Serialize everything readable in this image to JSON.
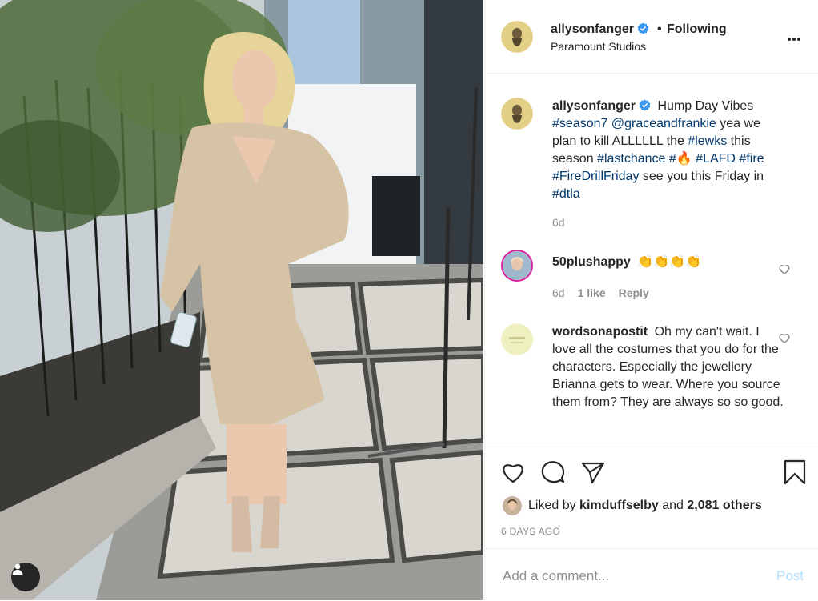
{
  "header": {
    "username": "allysonfanger",
    "separator": "•",
    "follow_status": "Following",
    "location": "Paramount Studios"
  },
  "caption": {
    "username": "allysonfanger",
    "parts": [
      {
        "text": "Hump Day Vibes ",
        "tag": false
      },
      {
        "text": "#season7",
        "tag": true
      },
      {
        "text": " ",
        "tag": false
      },
      {
        "text": "@graceandfrankie",
        "tag": true
      },
      {
        "text": " yea we plan to kill ALLLLLL the ",
        "tag": false
      },
      {
        "text": "#lewks",
        "tag": true
      },
      {
        "text": " this season ",
        "tag": false
      },
      {
        "text": "#lastchance",
        "tag": true
      },
      {
        "text": " ",
        "tag": false
      },
      {
        "text": "#🔥",
        "tag": true
      },
      {
        "text": " ",
        "tag": false
      },
      {
        "text": "#LAFD",
        "tag": true
      },
      {
        "text": " ",
        "tag": false
      },
      {
        "text": "#fire",
        "tag": true
      },
      {
        "text": " ",
        "tag": false
      },
      {
        "text": "#FireDrillFriday",
        "tag": true
      },
      {
        "text": " see you this Friday in ",
        "tag": false
      },
      {
        "text": "#dtla",
        "tag": true
      }
    ],
    "age": "6d"
  },
  "comments": [
    {
      "username": "50plushappy",
      "text": "👏👏👏👏",
      "age": "6d",
      "likes": "1 like",
      "reply": "Reply"
    },
    {
      "username": "wordsonapostit",
      "text": "Oh my can't wait. I love all the costumes that you do for the characters. Especially the jewellery Brianna gets to wear. Where you source them from? They are always so so good."
    }
  ],
  "likes": {
    "prefix": "Liked by",
    "user": "kimduffselby",
    "middle": "and",
    "others": "2,081 others"
  },
  "timestamp": "6 DAYS AGO",
  "add_comment": {
    "placeholder": "Add a comment...",
    "post_label": "Post"
  },
  "colors": {
    "text": "#262626",
    "muted": "#8e8e8e",
    "link": "#00376b",
    "verified": "#3897f0",
    "post_disabled": "#b2dffc",
    "divider": "#efefef"
  },
  "icons": {
    "verified": "verified-badge-icon",
    "more": "more-options-icon",
    "like": "heart-icon",
    "comment": "comment-bubble-icon",
    "share": "paper-plane-icon",
    "save": "bookmark-icon",
    "user_tag": "user-tag-icon"
  }
}
